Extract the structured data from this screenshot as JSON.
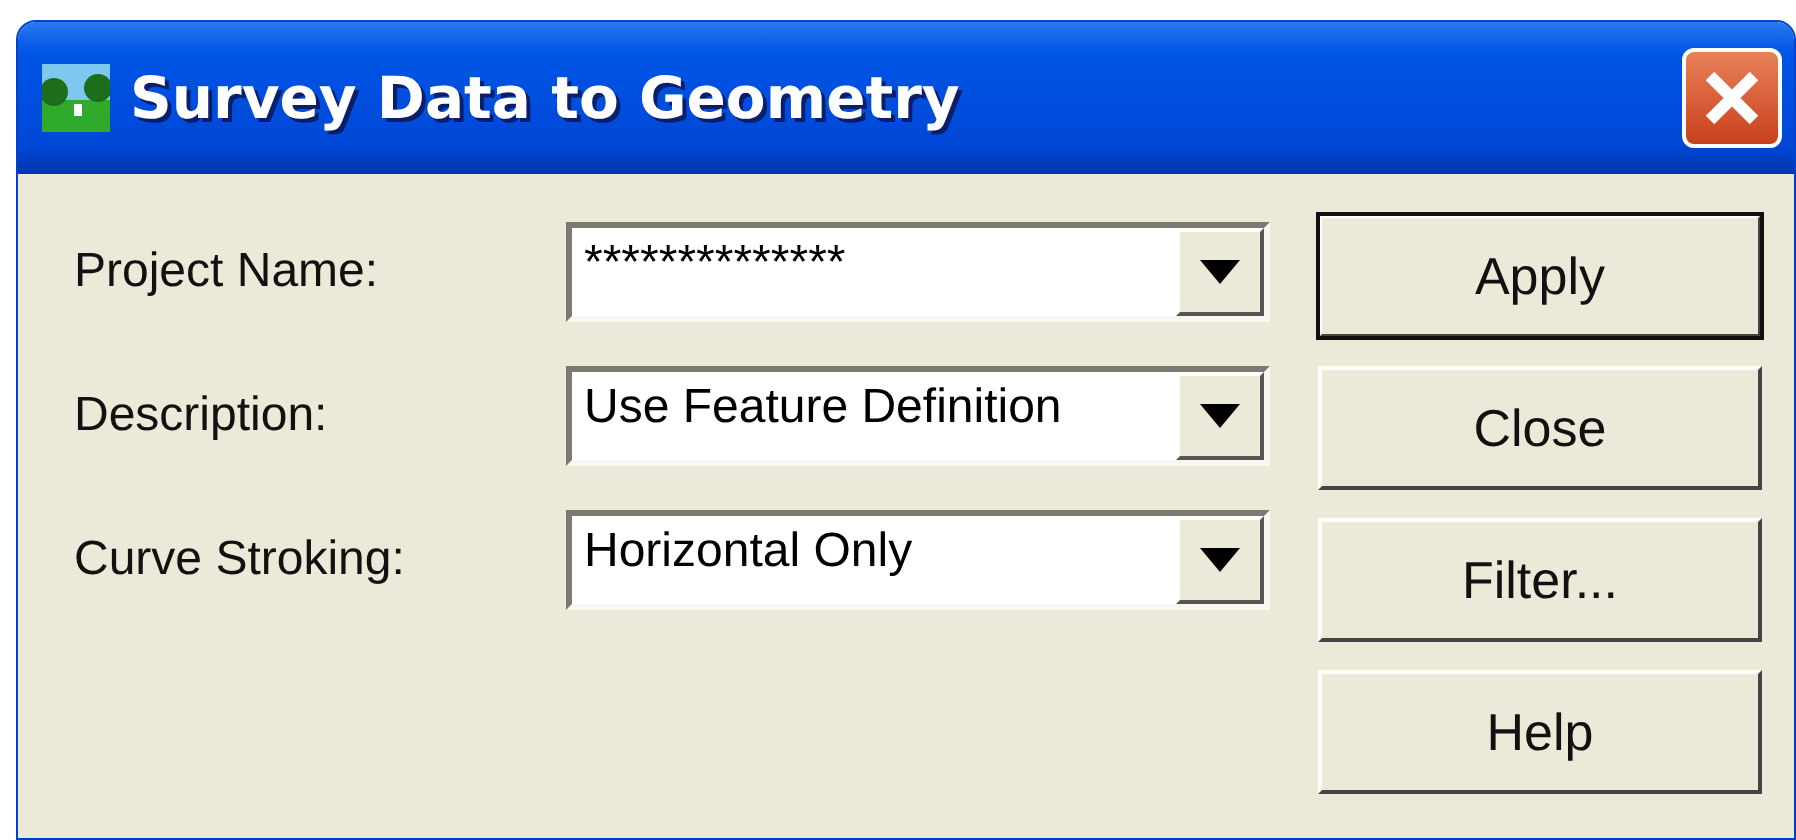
{
  "window": {
    "title": "Survey Data to Geometry"
  },
  "fields": [
    {
      "label": "Project Name:",
      "value": "**************"
    },
    {
      "label": "Description:",
      "value": "Use Feature Definition"
    },
    {
      "label": "Curve Stroking:",
      "value": "Horizontal Only"
    }
  ],
  "buttons": [
    {
      "label": "Apply",
      "selected": true
    },
    {
      "label": "Close",
      "selected": false
    },
    {
      "label": "Filter...",
      "selected": false
    },
    {
      "label": "Help",
      "selected": false
    }
  ]
}
